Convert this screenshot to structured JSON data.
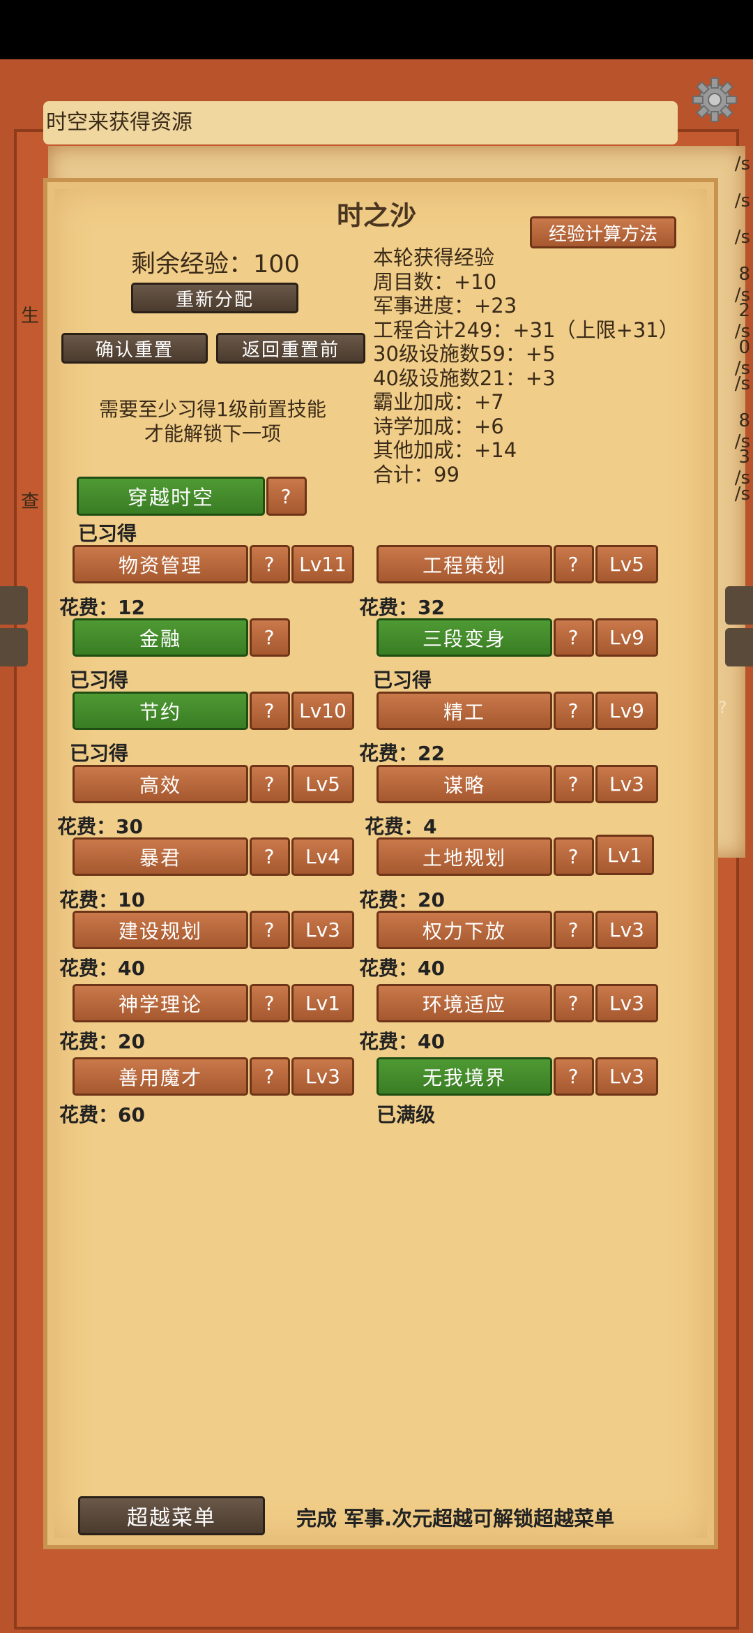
{
  "background": {
    "top_input_text": "时空来获得资源",
    "rates": [
      "/s",
      "/s",
      "/s",
      "8 /s",
      "2 /s",
      "0 /s",
      "/s",
      "8 /s",
      "3 /s",
      "/s"
    ],
    "left_frag_1": "生",
    "left_frag_2": "查",
    "right_frag": "?"
  },
  "dialog": {
    "title": "时之沙",
    "exp_method_button": "经验计算方法",
    "remaining_exp": "剩余经验：100",
    "reallocate_button": "重新分配",
    "confirm_reset_button": "确认重置",
    "revert_button": "返回重置前",
    "notice_line1": "需要至少习得1级前置技能",
    "notice_line2": "才能解锁下一项",
    "stats": [
      "本轮获得经验",
      "周目数：+10",
      "军事进度：+23",
      "工程合计249：+31（上限+31）",
      "30级设施数59：+5",
      "40级设施数21：+3",
      "霸业加成：+7",
      "诗学加成：+6",
      "其他加成：+14",
      "合计：99"
    ],
    "root_skill": {
      "label": "穿越时空",
      "help": "?",
      "status": "已习得"
    },
    "skills_left": [
      {
        "label": "物资管理",
        "help": "?",
        "level": "Lv11",
        "status": "花费：12"
      },
      {
        "label": "金融",
        "help": "?",
        "level": "",
        "status": "已习得"
      },
      {
        "label": "节约",
        "help": "?",
        "level": "Lv10",
        "status": "已习得"
      },
      {
        "label": "高效",
        "help": "?",
        "level": "Lv5",
        "status": "花费：30"
      },
      {
        "label": "暴君",
        "help": "?",
        "level": "Lv4",
        "status": "花费：10"
      },
      {
        "label": "建设规划",
        "help": "?",
        "level": "Lv3",
        "status": "花费：40"
      },
      {
        "label": "神学理论",
        "help": "?",
        "level": "Lv1",
        "status": "花费：20"
      },
      {
        "label": "善用魔才",
        "help": "?",
        "level": "Lv3",
        "status": "花费：60"
      }
    ],
    "skills_right": [
      {
        "label": "工程策划",
        "help": "?",
        "level": "Lv5",
        "status": "花费：32"
      },
      {
        "label": "三段变身",
        "help": "?",
        "level": "Lv9",
        "status": "已习得"
      },
      {
        "label": "精工",
        "help": "?",
        "level": "Lv9",
        "status": "花费：22"
      },
      {
        "label": "谋略",
        "help": "?",
        "level": "Lv3",
        "status": "花费：4"
      },
      {
        "label": "土地规划",
        "help": "?",
        "level": "Lv1",
        "status": "花费：20"
      },
      {
        "label": "权力下放",
        "help": "?",
        "level": "Lv3",
        "status": "花费：40"
      },
      {
        "label": "环境适应",
        "help": "?",
        "level": "Lv3",
        "status": "花费：40"
      },
      {
        "label": "无我境界",
        "help": "?",
        "level": "Lv3",
        "status": "已满级"
      }
    ],
    "transcend_button": "超越菜单",
    "transcend_hint": "完成 军事.次元超越可解锁超越菜单"
  }
}
